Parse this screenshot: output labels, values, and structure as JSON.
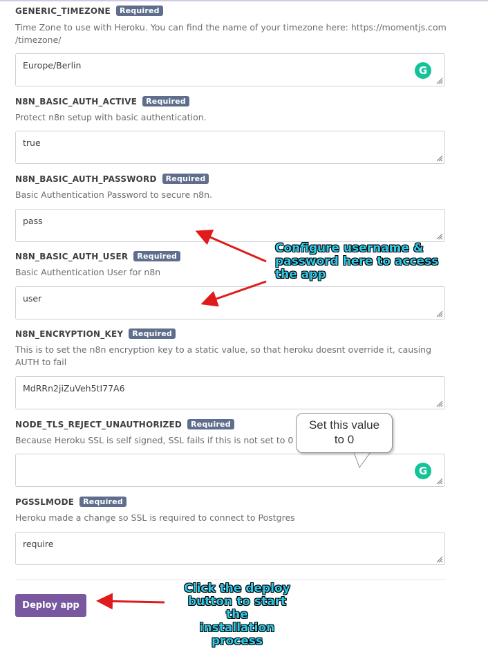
{
  "fields": [
    {
      "name": "GENERIC_TIMEZONE",
      "badge": "Required",
      "description": "Time Zone to use with Heroku. You can find the name of your timezone here: https://momentjs.com /timezone/",
      "value": "Europe/Berlin"
    },
    {
      "name": "N8N_BASIC_AUTH_ACTIVE",
      "badge": "Required",
      "description": "Protect n8n setup with basic authentication.",
      "value": "true"
    },
    {
      "name": "N8N_BASIC_AUTH_PASSWORD",
      "badge": "Required",
      "description": "Basic Authentication Password to secure n8n.",
      "value": "pass"
    },
    {
      "name": "N8N_BASIC_AUTH_USER",
      "badge": "Required",
      "description": "Basic Authentication User for n8n",
      "value": "user"
    },
    {
      "name": "N8N_ENCRYPTION_KEY",
      "badge": "Required",
      "description": "This is to set the n8n encryption key to a static value, so that heroku doesnt override it, causing AUTH to fail",
      "value": "MdRRn2jiZuVeh5tI77A6"
    },
    {
      "name": "NODE_TLS_REJECT_UNAUTHORIZED",
      "badge": "Required",
      "description": "Because Heroku SSL is self signed, SSL fails if this is not set to 0",
      "value": ""
    },
    {
      "name": "PGSSLMODE",
      "badge": "Required",
      "description": "Heroku made a change so SSL is required to connect to Postgres",
      "value": "require"
    }
  ],
  "grammarly_icon": "G",
  "deploy_label": "Deploy app",
  "annotations": {
    "configure": "Configure username & password here to access the app",
    "configure_lines": [
      "Configure username &",
      "password here to access",
      "the app"
    ],
    "bubble_lines": [
      "Set this value",
      "to 0"
    ],
    "deploy_lines": [
      "Click the deploy",
      "button to start the",
      "installation process"
    ]
  },
  "colors": {
    "badge": "#5f6e8c",
    "deploy": "#79589f",
    "annotation_text": "#2ec8e8",
    "arrow": "#e01b1b",
    "grammarly": "#15c39a"
  }
}
